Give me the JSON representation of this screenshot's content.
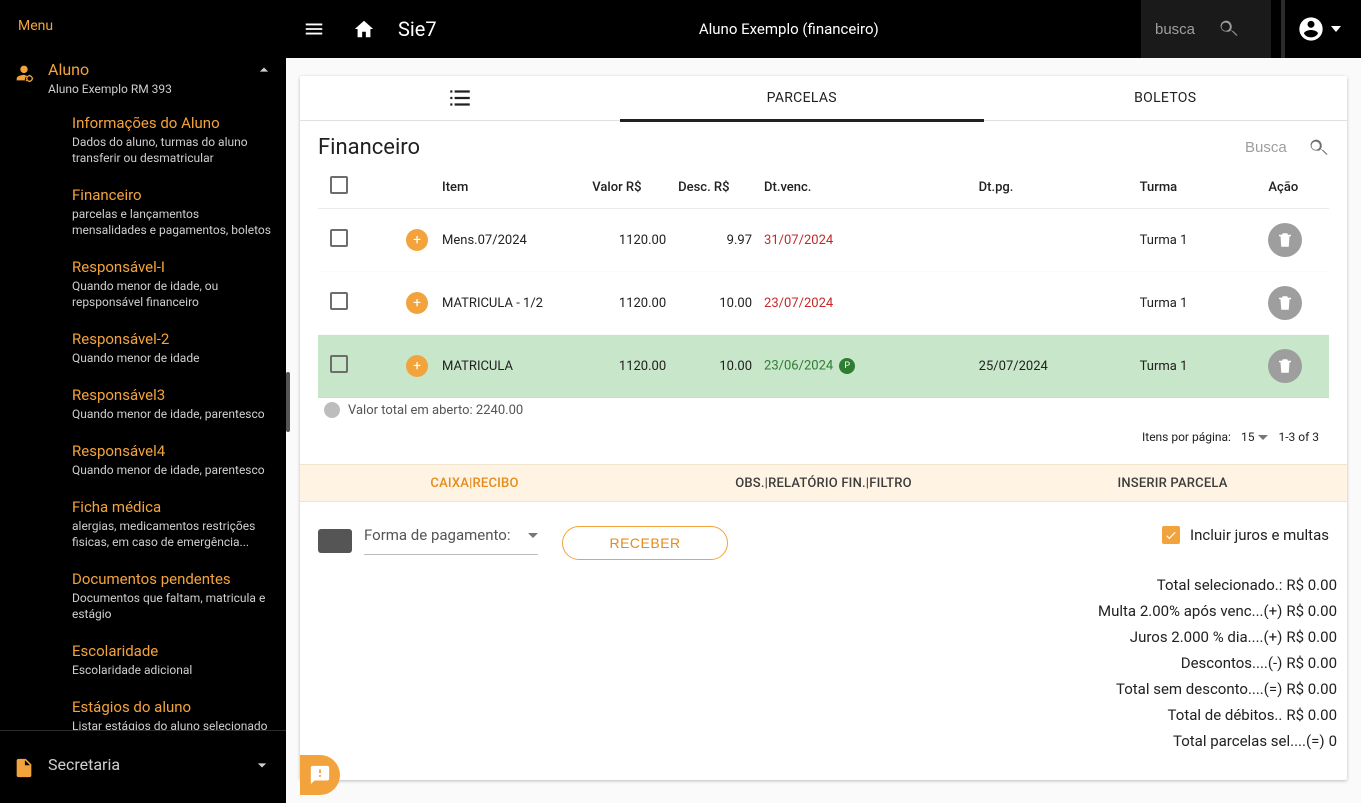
{
  "sidebar": {
    "menu_label": "Menu",
    "section_aluno": {
      "title": "Aluno",
      "sub": "Aluno Exemplo RM 393"
    },
    "items": [
      {
        "t": "Informações do Aluno",
        "d": "Dados do aluno, turmas do aluno transferir ou desmatricular"
      },
      {
        "t": "Financeiro",
        "d": "parcelas e lançamentos mensalidades e pagamentos, boletos"
      },
      {
        "t": "Responsável-I",
        "d": "Quando menor de idade, ou repsponsável financeiro"
      },
      {
        "t": "Responsável-2",
        "d": "Quando menor de idade"
      },
      {
        "t": "Responsável3",
        "d": "Quando menor de idade, parentesco"
      },
      {
        "t": "Responsável4",
        "d": "Quando menor de idade, parentesco"
      },
      {
        "t": "Ficha médica",
        "d": "alergias, medicamentos restrições fisicas, em caso de emergência..."
      },
      {
        "t": "Documentos pendentes",
        "d": "Documentos que faltam, matricula e estágio"
      },
      {
        "t": "Escolaridade",
        "d": "Escolaridade adicional"
      },
      {
        "t": "Estágios do aluno",
        "d": "Listar estágios do aluno selecionado"
      }
    ],
    "section_secretaria": {
      "title": "Secretaria"
    }
  },
  "header": {
    "brand": "Sie7",
    "context": "Aluno Exemplo (financeiro)",
    "search_placeholder": "busca"
  },
  "top_tabs": {
    "parcelas": "PARCELAS",
    "boletos": "BOLETOS"
  },
  "panel": {
    "title": "Financeiro",
    "search_placeholder": "Busca",
    "columns": {
      "item": "Item",
      "valor": "Valor R$",
      "desc": "Desc. R$",
      "dtvenc": "Dt.venc.",
      "dtpg": "Dt.pg.",
      "turma": "Turma",
      "acao": "Ação"
    },
    "rows": [
      {
        "item": "Mens.07/2024",
        "valor": "1120.00",
        "desc": "9.97",
        "dtvenc": "31/07/2024",
        "dtvenc_cls": "due-late",
        "dtpg": "",
        "turma": "Turma 1",
        "paid": false
      },
      {
        "item": "MATRICULA - 1/2",
        "valor": "1120.00",
        "desc": "10.00",
        "dtvenc": "23/07/2024",
        "dtvenc_cls": "due-late",
        "dtpg": "",
        "turma": "Turma 1",
        "paid": false
      },
      {
        "item": "MATRICULA",
        "valor": "1120.00",
        "desc": "10.00",
        "dtvenc": "23/06/2024",
        "dtvenc_cls": "due-ok",
        "dtpg": "25/07/2024",
        "turma": "Turma 1",
        "paid": true,
        "badge": "P"
      }
    ],
    "total_open": "Valor total em aberto: 2240.00",
    "paginator": {
      "label": "Itens por página:",
      "size": "15",
      "range": "1-3 of 3"
    }
  },
  "bottom_tabs": {
    "caixa": "CAIXA|RECIBO",
    "obs": "OBS.|RELATÓRIO FIN.|FILTRO",
    "inserir": "INSERIR PARCELA"
  },
  "pay": {
    "field_label": "Forma de pagamento:",
    "btn": "RECEBER",
    "incl": "Incluir juros e multas"
  },
  "totals": [
    {
      "lbl": "Total selecionado.:",
      "val": "R$ 0.00"
    },
    {
      "lbl": "Multa 2.00% após venc...(+)",
      "val": "R$ 0.00"
    },
    {
      "lbl": "Juros 2.000 % dia....(+)",
      "val": "R$ 0.00"
    },
    {
      "lbl": "Descontos....(-)",
      "val": "R$ 0.00"
    },
    {
      "lbl": "Total sem desconto....(=)",
      "val": "R$ 0.00"
    },
    {
      "lbl": "Total de débitos..",
      "val": "R$ 0.00"
    },
    {
      "lbl": "Total parcelas sel....(=)",
      "val": "0"
    }
  ]
}
